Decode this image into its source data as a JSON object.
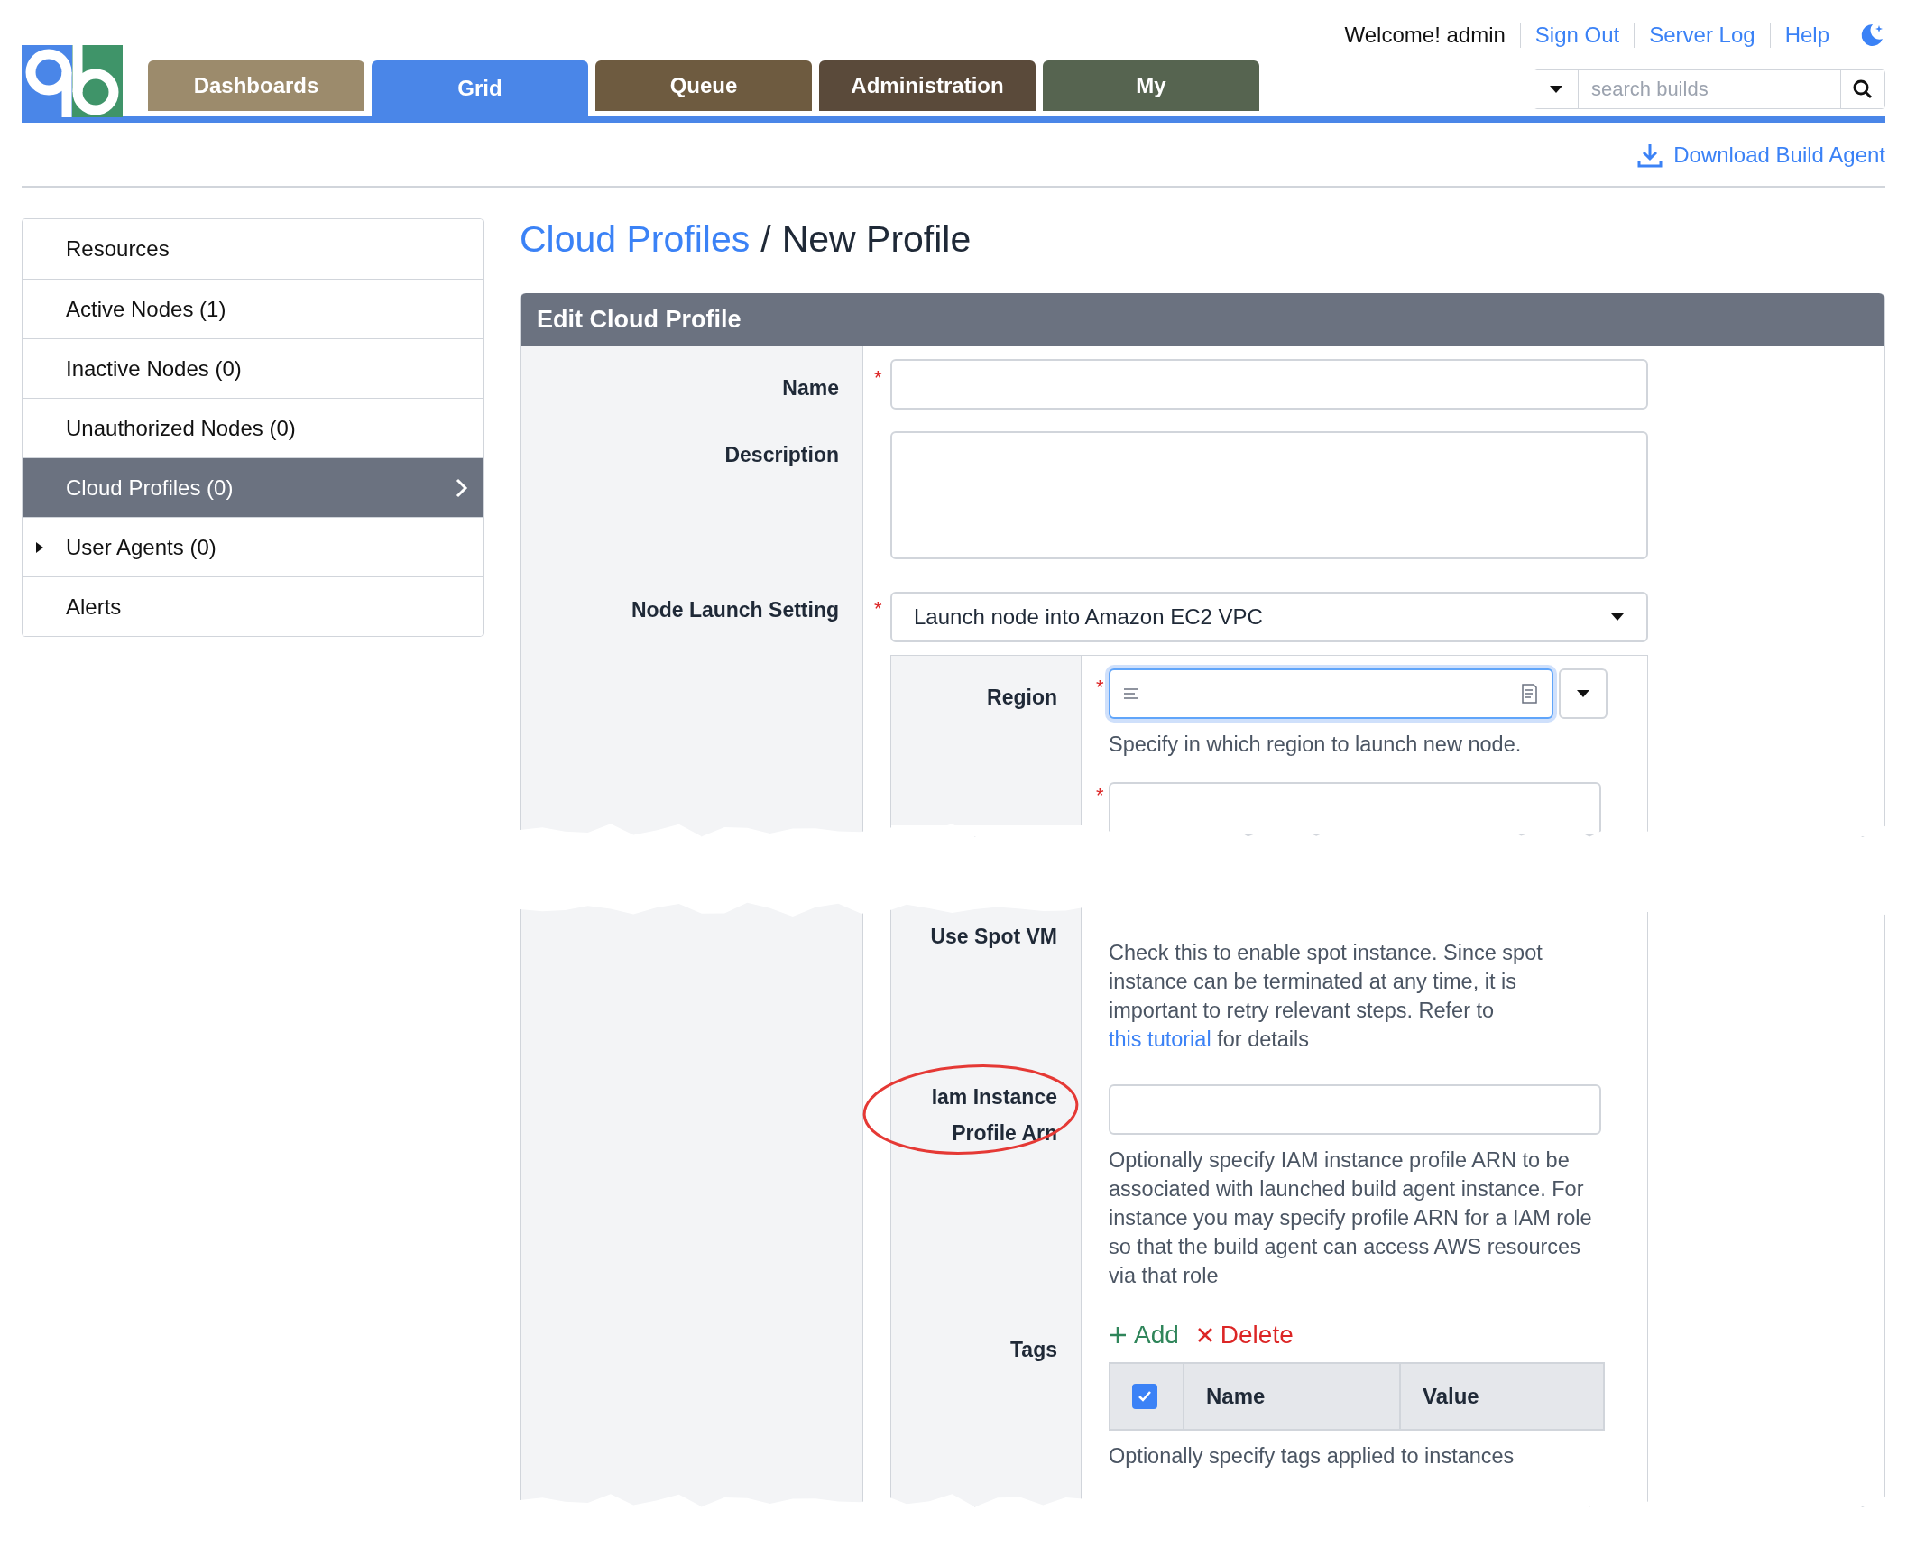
{
  "header": {
    "greeting": "Welcome! admin",
    "links": [
      "Sign Out",
      "Server Log",
      "Help"
    ],
    "tabs": [
      {
        "label": "Dashboards",
        "selected": false,
        "color": "#9c8b6c"
      },
      {
        "label": "Grid",
        "selected": true,
        "color": "#4a86e8"
      },
      {
        "label": "Queue",
        "selected": false,
        "color": "#6e5b40"
      },
      {
        "label": "Administration",
        "selected": false,
        "color": "#5a4a3a"
      },
      {
        "label": "My",
        "selected": false,
        "color": "#566450"
      }
    ],
    "search": {
      "placeholder": "search builds"
    },
    "download_link": "Download Build Agent"
  },
  "sidebar": {
    "items": [
      {
        "label": "Resources",
        "selected": false,
        "kind": "link"
      },
      {
        "label": "Active Nodes (1)",
        "selected": false,
        "kind": "link"
      },
      {
        "label": "Inactive Nodes (0)",
        "selected": false,
        "kind": "link"
      },
      {
        "label": "Unauthorized Nodes (0)",
        "selected": false,
        "kind": "link"
      },
      {
        "label": "Cloud Profiles (0)",
        "selected": true,
        "kind": "link"
      },
      {
        "label": "User Agents (0)",
        "selected": false,
        "kind": "group"
      },
      {
        "label": "Alerts",
        "selected": false,
        "kind": "link"
      }
    ]
  },
  "breadcrumb": {
    "link": "Cloud Profiles",
    "separator": "/",
    "current": "New Profile"
  },
  "form": {
    "title": "Edit Cloud Profile",
    "required_mark": "*",
    "fields": [
      {
        "label": "Name",
        "required": true,
        "kind": "text"
      },
      {
        "label": "Description",
        "required": false,
        "kind": "textarea"
      },
      {
        "label": "Node Launch Setting",
        "required": true,
        "kind": "select",
        "value": "Launch node into Amazon EC2 VPC"
      }
    ],
    "region": {
      "label": "Region",
      "required": true,
      "focused": true,
      "help": "Specify in which region to launch new node."
    },
    "ami": {
      "required": true
    },
    "spot": {
      "label": "Use Spot VM",
      "help": "Check this to enable spot instance. Since spot instance can be terminated at any time, it is important to retry relevant steps. Refer to",
      "link": "this tutorial",
      "help_end": "for details"
    },
    "iam": {
      "label": "Iam Instance Profile Arn",
      "help": "Optionally specify IAM instance profile ARN to be associated with launched build agent instance. For instance you may specify profile ARN for a IAM role so that the build agent can access AWS resources via that role"
    },
    "tags": {
      "label": "Tags",
      "actions": [
        {
          "label": "Add",
          "kind": "add"
        },
        {
          "label": "Delete",
          "kind": "delete"
        }
      ],
      "select_all_checked": true,
      "columns": [
        "Name",
        "Value"
      ],
      "help": "Optionally specify tags applied to instances"
    }
  }
}
